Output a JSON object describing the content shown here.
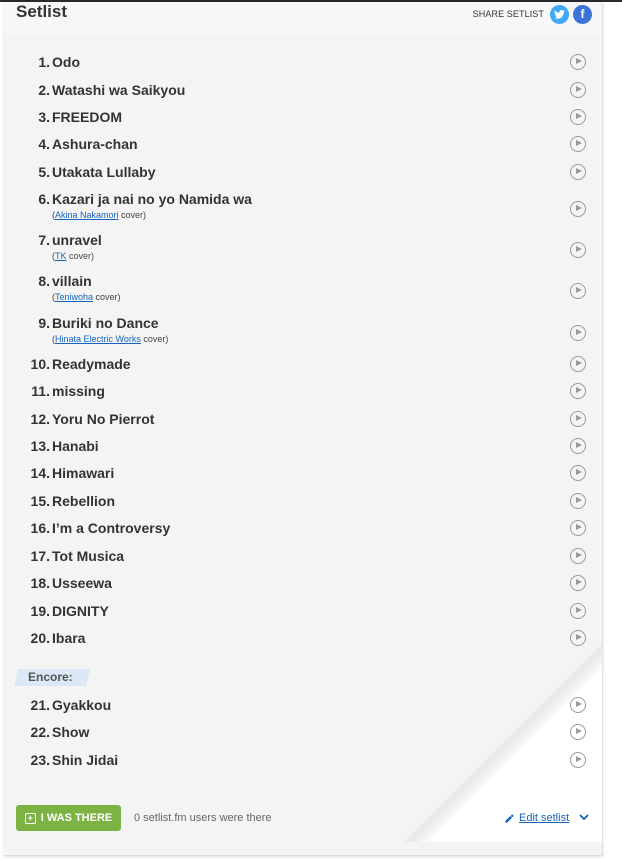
{
  "header": {
    "title": "Setlist",
    "share_label": "SHARE SETLIST",
    "twitter_icon": "twitter-icon",
    "facebook_icon": "facebook-icon"
  },
  "songs": [
    {
      "num": "1.",
      "name": "Odo"
    },
    {
      "num": "2.",
      "name": "Watashi wa Saikyou"
    },
    {
      "num": "3.",
      "name": "FREEDOM"
    },
    {
      "num": "4.",
      "name": "Ashura-chan"
    },
    {
      "num": "5.",
      "name": "Utakata Lullaby"
    },
    {
      "num": "6.",
      "name": "Kazari ja nai no yo Namida wa",
      "open": "(",
      "artist": "Akina Nakamori",
      "suffix": " cover)"
    },
    {
      "num": "7.",
      "name": "unravel",
      "open": "(",
      "artist": "TK",
      "suffix": " cover)"
    },
    {
      "num": "8.",
      "name": "villain",
      "open": "(",
      "artist": "Teniwoha",
      "suffix": " cover)"
    },
    {
      "num": "9.",
      "name": "Buriki no Dance",
      "open": "(",
      "artist": "Hinata Electric Works",
      "suffix": " cover)"
    },
    {
      "num": "10.",
      "name": "Readymade"
    },
    {
      "num": "11.",
      "name": "missing"
    },
    {
      "num": "12.",
      "name": "Yoru No Pierrot"
    },
    {
      "num": "13.",
      "name": "Hanabi"
    },
    {
      "num": "14.",
      "name": "Himawari"
    },
    {
      "num": "15.",
      "name": "Rebellion"
    },
    {
      "num": "16.",
      "name": "I’m a Controversy"
    },
    {
      "num": "17.",
      "name": "Tot Musica"
    },
    {
      "num": "18.",
      "name": "Usseewa"
    },
    {
      "num": "19.",
      "name": "DIGNITY"
    },
    {
      "num": "20.",
      "name": "Ibara"
    }
  ],
  "encore": {
    "label": "Encore:",
    "songs": [
      {
        "num": "21.",
        "name": "Gyakkou"
      },
      {
        "num": "22.",
        "name": "Show"
      },
      {
        "num": "23.",
        "name": "Shin Jidai"
      }
    ]
  },
  "footer": {
    "there_button": "I WAS THERE",
    "users_text": "0 setlist.fm users were there",
    "edit_label": "Edit setlist"
  },
  "colors": {
    "accent_green": "#7cb342",
    "link_blue": "#1565c0",
    "twitter": "#3fa9f5",
    "facebook": "#3b73d6"
  }
}
